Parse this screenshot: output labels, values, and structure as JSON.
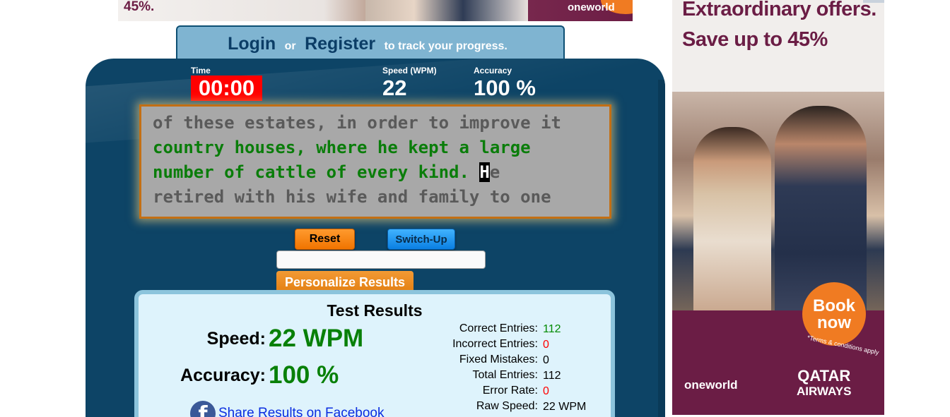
{
  "top_ad": {
    "text": "45%.",
    "brand": "oneworld"
  },
  "login": {
    "login_label": "Login",
    "or_label": "or",
    "register_label": "Register",
    "suffix": "to track your progress."
  },
  "stats": {
    "time_label": "Time",
    "time_value": "00:00",
    "speed_label": "Speed (WPM)",
    "speed_value": "22",
    "accuracy_label": "Accuracy",
    "accuracy_value": "100 %"
  },
  "typing_text": {
    "line1": "of these estates, in order to improve it",
    "line2_typed": "country houses, where he kept a large",
    "line3_typed": "number of cattle of every kind. ",
    "cursor_char": "H",
    "line3_rest": "e",
    "line4": "retired with his wife and family to one"
  },
  "controls": {
    "reset_label": "Reset",
    "switch_label": "Switch-Up",
    "input_value": "",
    "personalize_label": "Personalize Results"
  },
  "results": {
    "title": "Test Results",
    "speed_label": "Speed:",
    "speed_value": "22 WPM",
    "accuracy_label": "Accuracy:",
    "accuracy_value": "100 %",
    "share_label": "Share Results on Facebook",
    "details": [
      {
        "label": "Correct Entries:",
        "value": "112",
        "color": "green"
      },
      {
        "label": "Incorrect Entries:",
        "value": "0",
        "color": "red"
      },
      {
        "label": "Fixed Mistakes:",
        "value": "0",
        "color": "black"
      },
      {
        "label": "Total Entries:",
        "value": "112",
        "color": "black"
      },
      {
        "label": "Error Rate:",
        "value": "0",
        "color": "red"
      },
      {
        "label": "Raw Speed:",
        "value": "22 WPM",
        "color": "black"
      }
    ]
  },
  "side_ad": {
    "headline": "Extraordinary offers. Save up to 45%",
    "book_line1": "Book",
    "book_line2": "now",
    "terms": "*Terms & conditions apply",
    "brand": "oneworld",
    "airline_line1": "QATAR",
    "airline_line2": "AIRWAYS"
  },
  "colors": {
    "panel": "#0d4466",
    "timer_bg": "#ff0000",
    "typed_text": "#0a7d0a",
    "result_green": "#088008",
    "ad_brand": "#6b1d45"
  }
}
